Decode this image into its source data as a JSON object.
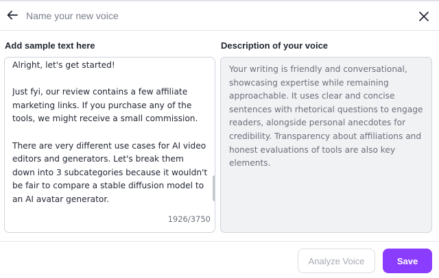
{
  "header": {
    "back_icon": "arrow-left-icon",
    "name_placeholder": "Name your new voice",
    "name_value": "",
    "close_icon": "close-icon"
  },
  "sample": {
    "label": "Add sample text here",
    "text": "Alright, let's get started!\n\nJust fyi, our review contains a few affiliate marketing links. If you purchase any of the tools, we might receive a small commission.\n\nThere are very different use cases for AI video editors and generators. Let's break them down into 3 subcategories because it wouldn't be fair to compare a stable diffusion model to an AI avatar generator.",
    "char_count": "1926/3750"
  },
  "description": {
    "label": "Description of your voice",
    "text": "Your writing is friendly and conversational, showcasing expertise while remaining approachable. It uses clear and concise sentences with rhetorical questions to engage readers, alongside personal anecdotes for credibility. Transparency about affiliations and honest evaluations of tools are also key elements."
  },
  "footer": {
    "analyze_label": "Analyze Voice",
    "save_label": "Save"
  },
  "colors": {
    "accent": "#8b3dff",
    "description_bg": "#f1f2f4",
    "disabled_text": "#a5a9b1"
  }
}
